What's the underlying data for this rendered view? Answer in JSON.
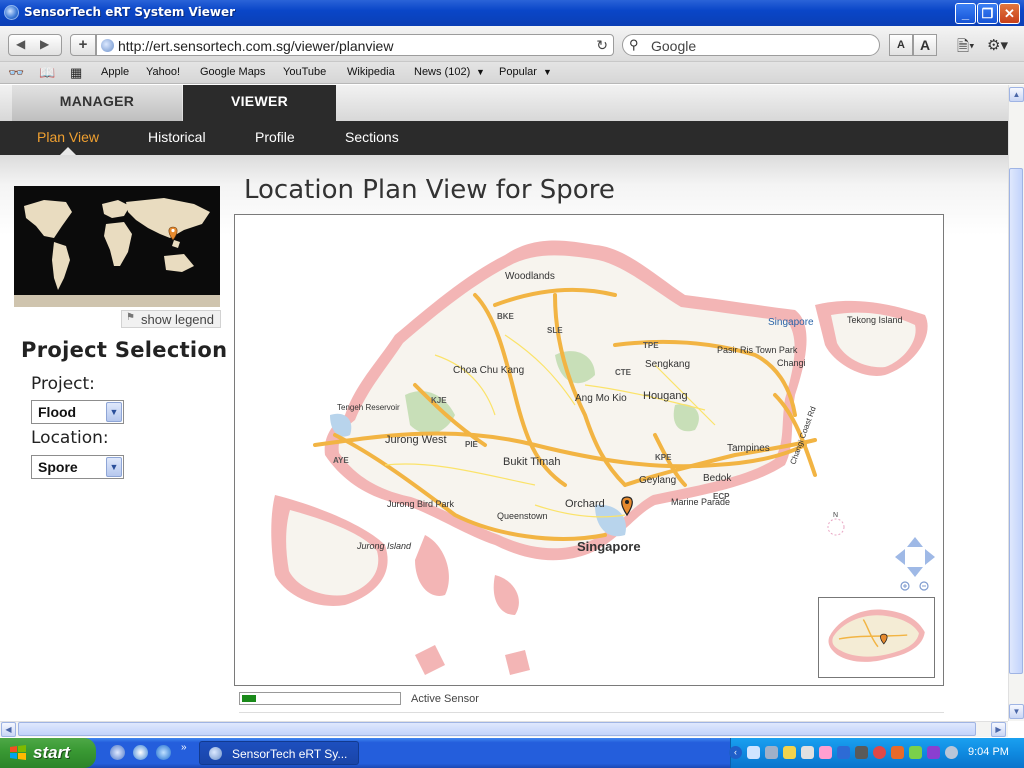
{
  "window": {
    "title": "SensorTech eRT System Viewer"
  },
  "browser": {
    "url": "http://ert.sensortech.com.sg/viewer/planview",
    "search_placeholder": "Google",
    "font_smaller": "A",
    "font_larger": "A",
    "bookmarks": [
      "Apple",
      "Yahoo!",
      "Google Maps",
      "YouTube",
      "Wikipedia",
      "News (102)",
      "Popular"
    ]
  },
  "app": {
    "tabs": [
      {
        "label": "MANAGER",
        "active": false
      },
      {
        "label": "VIEWER",
        "active": true
      }
    ],
    "subnav": [
      {
        "label": "Plan View",
        "active": true
      },
      {
        "label": "Historical",
        "active": false
      },
      {
        "label": "Profile",
        "active": false
      },
      {
        "label": "Sections",
        "active": false
      }
    ],
    "show_legend_label": "show legend",
    "project_selection_title": "Project Selection",
    "project": {
      "label": "Project:",
      "value": "Flood"
    },
    "location": {
      "label": "Location:",
      "value": "Spore"
    },
    "map_title": "Location Plan View for Spore",
    "map_labels": [
      "Woodlands",
      "Singapore",
      "Choa Chu Kang",
      "Sengkang",
      "Pasir Ris Town Park",
      "Changi",
      "Tekong Island",
      "Ang Mo Kio",
      "Hougang",
      "Jurong West",
      "Bukit Timah",
      "Tampines",
      "Geylang",
      "Bedok",
      "Orchard",
      "Marine Parade",
      "Jurong Bird Park",
      "Queenstown",
      "Jurong Island",
      "Changi Coast Rd",
      "BKE",
      "SLE",
      "TPE",
      "CTE",
      "KJE",
      "PIE",
      "AYE",
      "KPE",
      "ECP",
      "Tengeh Reservoir",
      "N"
    ],
    "legend": {
      "label": "Active Sensor",
      "color": "#1a8a1a"
    }
  },
  "taskbar": {
    "start_label": "start",
    "task_label": "SensorTech eRT Sy...",
    "clock": "9:04 PM"
  },
  "colors": {
    "accent": "#f0a030",
    "nav_dark": "#2b2b2b",
    "map_road": "#f2b443",
    "map_land": "#f5f3ee",
    "map_coast": "#f2a6a6"
  }
}
